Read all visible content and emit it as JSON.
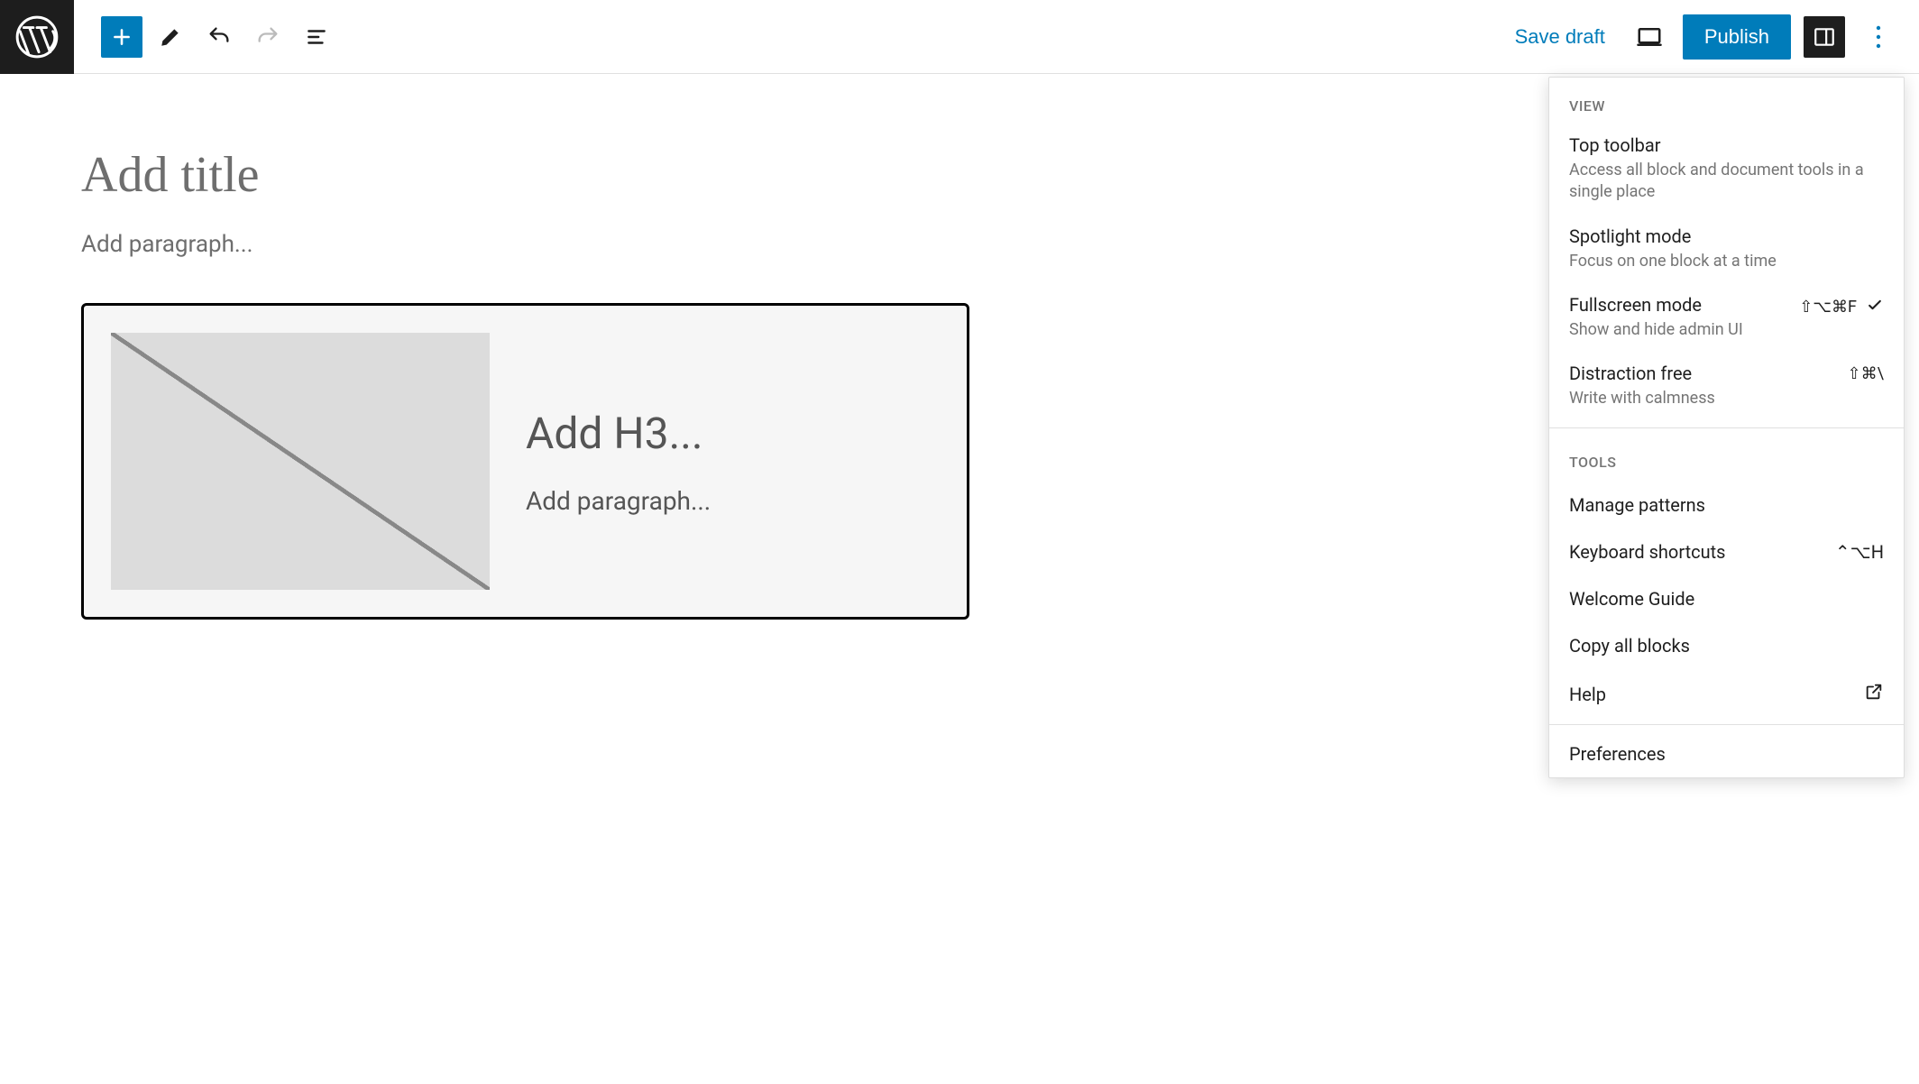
{
  "header": {
    "save_draft": "Save draft",
    "publish": "Publish"
  },
  "editor": {
    "title_placeholder": "Add title",
    "paragraph_placeholder": "Add paragraph...",
    "media_block": {
      "heading_placeholder": "Add H3...",
      "paragraph_placeholder": "Add paragraph..."
    }
  },
  "menu": {
    "view_label": "VIEW",
    "tools_label": "TOOLS",
    "view_items": [
      {
        "title": "Top toolbar",
        "desc": "Access all block and document tools in a single place",
        "shortcut": "",
        "checked": false
      },
      {
        "title": "Spotlight mode",
        "desc": "Focus on one block at a time",
        "shortcut": "",
        "checked": false
      },
      {
        "title": "Fullscreen mode",
        "desc": "Show and hide admin UI",
        "shortcut": "⇧⌥⌘F",
        "checked": true
      },
      {
        "title": "Distraction free",
        "desc": "Write with calmness",
        "shortcut": "⇧⌘\\",
        "checked": false
      }
    ],
    "tools_items": [
      {
        "title": "Manage patterns",
        "shortcut": "",
        "icon": ""
      },
      {
        "title": "Keyboard shortcuts",
        "shortcut": "⌃⌥H",
        "icon": ""
      },
      {
        "title": "Welcome Guide",
        "shortcut": "",
        "icon": ""
      },
      {
        "title": "Copy all blocks",
        "shortcut": "",
        "icon": ""
      },
      {
        "title": "Help",
        "shortcut": "",
        "icon": "external"
      }
    ],
    "preferences": "Preferences"
  }
}
